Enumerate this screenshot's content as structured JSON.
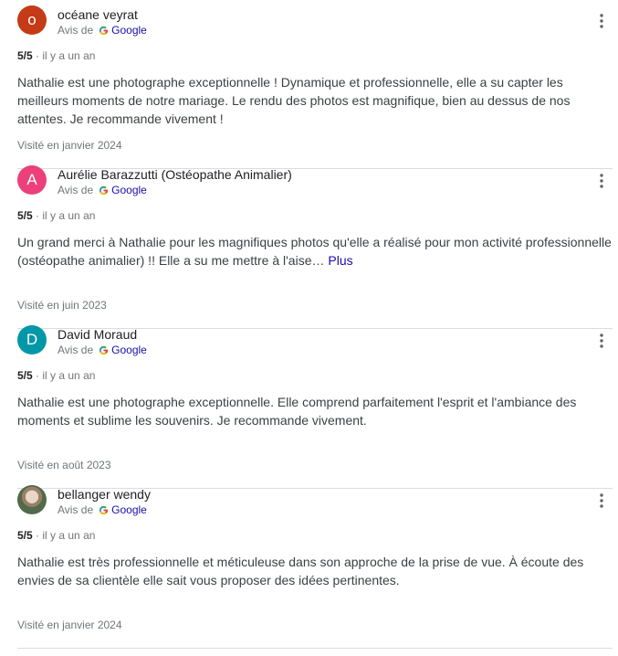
{
  "reviews": [
    {
      "name": "océane veyrat",
      "avatar": {
        "type": "letter",
        "letter": "o",
        "color": "#c53a17"
      },
      "source_prefix": "Avis de",
      "source_name": "Google",
      "rating": "5/5",
      "time": "il y a un an",
      "text": "Nathalie est une photographe exceptionnelle ! Dynamique et professionnelle, elle a su capter les meilleurs moments de notre mariage. Le rendu des photos est magnifique, bien au dessus de nos attentes. Je recommande vivement !",
      "more_link": "",
      "visited": "Visité en janvier 2024"
    },
    {
      "name": "Aurélie Barazzutti (Ostéopathe Animalier)",
      "avatar": {
        "type": "letter",
        "letter": "A",
        "color": "#ec407a"
      },
      "source_prefix": "Avis de",
      "source_name": "Google",
      "rating": "5/5",
      "time": "il y a un an",
      "text": "Un grand merci à Nathalie pour les magnifiques photos qu'elle a réalisé pour mon activité professionnelle (ostéopathe animalier) !! Elle a su me mettre à l'aise…",
      "more_link": "Plus",
      "visited": "Visité en juin 2023"
    },
    {
      "name": "David Moraud",
      "avatar": {
        "type": "letter",
        "letter": "D",
        "color": "#0097a7"
      },
      "source_prefix": "Avis de",
      "source_name": "Google",
      "rating": "5/5",
      "time": "il y a un an",
      "text": "Nathalie est une photographe exceptionnelle. Elle comprend parfaitement l'esprit et l'ambiance des moments et sublime les souvenirs. Je recommande vivement.",
      "more_link": "",
      "visited": "Visité en août 2023"
    },
    {
      "name": "bellanger wendy",
      "avatar": {
        "type": "photo",
        "letter": "",
        "color": "#6f8a63"
      },
      "source_prefix": "Avis de",
      "source_name": "Google",
      "rating": "5/5",
      "time": "il y a un an",
      "text": "Nathalie est très professionnelle et méticuleuse dans son approche de la prise de vue. À écoute des envies de sa clientèle elle sait vous proposer des idées pertinentes.",
      "more_link": "",
      "visited": "Visité en janvier 2024"
    }
  ],
  "icons": {
    "more": "more-vert-icon",
    "source": "google-g-icon"
  },
  "colors": {
    "text": "#202124",
    "secondary": "#70757a",
    "link": "#1a0dab",
    "divider": "#dadce0"
  }
}
